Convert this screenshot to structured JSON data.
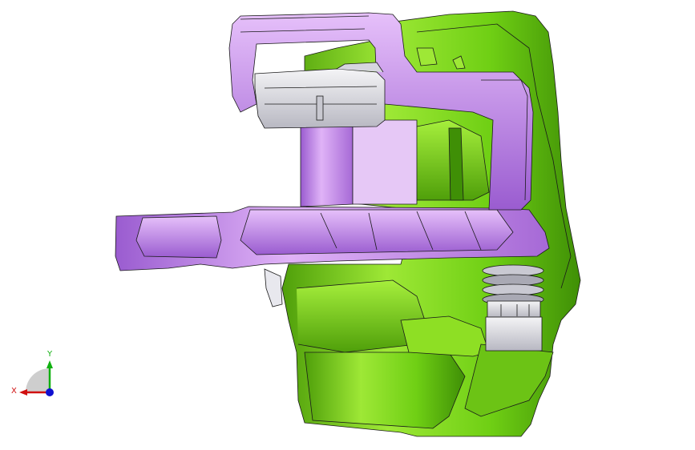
{
  "viewport": {
    "background": "#ffffff",
    "model": {
      "green_part": "#7fd81a",
      "green_shade": "#3f8f06",
      "purple_part": "#c58be8",
      "purple_shade": "#8a4fc0",
      "gray_part": "#e6e6ea",
      "gray_shade": "#9a9aa6",
      "edge_color": "#1a1a1a"
    },
    "triad": {
      "x_label": "X",
      "y_label": "Y",
      "x_color": "#d01010",
      "y_color": "#10b010",
      "z_color": "#1010d0",
      "origin_icon": "coordinate-triad-icon"
    }
  }
}
